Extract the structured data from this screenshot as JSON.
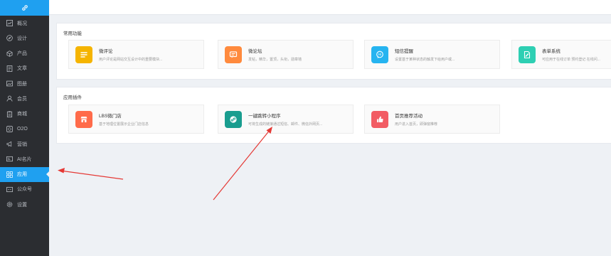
{
  "colors": {
    "sidebar_bg": "#2b2d31",
    "accent": "#1fa0f0",
    "annotation_arrow": "#e53935"
  },
  "logo_icon": "link-icon",
  "sidebar": {
    "items": [
      {
        "label": "概况",
        "icon": "chart-icon"
      },
      {
        "label": "设计",
        "icon": "compass-icon"
      },
      {
        "label": "产品",
        "icon": "cube-icon"
      },
      {
        "label": "文章",
        "icon": "document-icon"
      },
      {
        "label": "图册",
        "icon": "image-icon"
      },
      {
        "label": "会员",
        "icon": "user-icon"
      },
      {
        "label": "商城",
        "icon": "clipboard-icon"
      },
      {
        "label": "O2O",
        "icon": "o2o-icon"
      },
      {
        "label": "营销",
        "icon": "megaphone-icon"
      },
      {
        "label": "AI名片",
        "icon": "card-icon"
      },
      {
        "label": "应用",
        "icon": "grid-icon",
        "active": true
      },
      {
        "label": "公众号",
        "icon": "wechat-icon"
      },
      {
        "label": "设置",
        "icon": "gear-icon"
      }
    ]
  },
  "common": {
    "title": "常用功能",
    "items": [
      {
        "name": "微评论",
        "desc": "用户评论是网站交互设计中的重要模块...",
        "color": "#f5b400",
        "icon": "list-icon"
      },
      {
        "name": "微论坛",
        "desc": "发帖，精华，置顶，头衔，勋章墙",
        "color": "#ff8a3d",
        "icon": "chat-icon"
      },
      {
        "name": "短信提醒",
        "desc": "设置基于某种状态的触发下给用户或...",
        "color": "#26b4f0",
        "icon": "sms-icon"
      },
      {
        "name": "表单系统",
        "desc": "可应用于在线订单 预约登记 在线问...",
        "color": "#2ecfb3",
        "icon": "form-icon"
      }
    ]
  },
  "plugins": {
    "title": "应用插件",
    "items": [
      {
        "name": "LBS微门店",
        "desc": "基于地理位置展示企业门店信息",
        "color": "#ff6b4a",
        "icon": "store-icon"
      },
      {
        "name": "一键跳转小程序",
        "desc": "可将生成的链接通过短信、邮件、微信外网页...",
        "color": "#199d8f",
        "icon": "miniprogram-icon"
      },
      {
        "name": "首页推荐活动",
        "desc": "用户进入首页，即弹窗推荐",
        "color": "#f25c64",
        "icon": "thumbs-up-icon"
      }
    ]
  }
}
